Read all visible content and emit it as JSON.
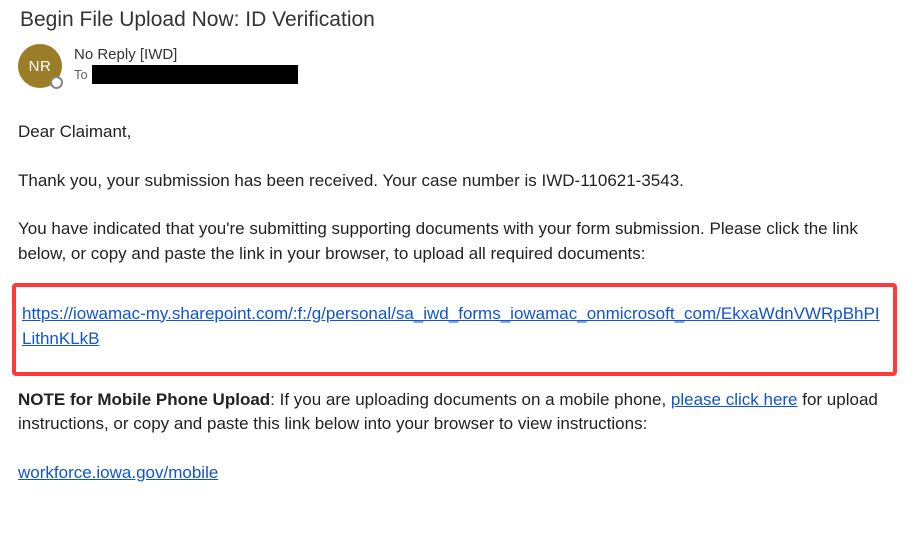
{
  "subject": "Begin File Upload Now: ID Verification",
  "avatar_initials": "NR",
  "sender_name": "No Reply [IWD]",
  "to_label": "To",
  "body": {
    "greeting": "Dear Claimant,",
    "thank_you": "Thank you, your submission has been received.  Your case number is IWD-110621-3543.",
    "submission_instruction": "You have indicated that you're submitting supporting documents with your form submission. Please click the link below, or copy and paste the link in your browser, to upload all required documents:",
    "sharepoint_link": "https://iowamac-my.sharepoint.com/:f:/g/personal/sa_iwd_forms_iowamac_onmicrosoft_com/EkxaWdnVWRpBhPILithnKLkB",
    "note_bold_label": "NOTE for Mobile Phone Upload",
    "note_text_before": ": If you are uploading documents on a mobile phone, ",
    "note_link_text": "please click here",
    "note_text_after": " for upload instructions, or copy and paste this link below into your browser to view instructions:",
    "mobile_link": "workforce.iowa.gov/mobile"
  }
}
